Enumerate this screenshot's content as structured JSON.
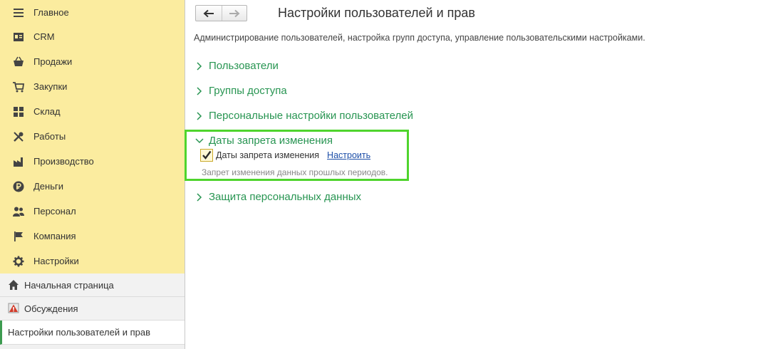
{
  "sidebar": {
    "menu": [
      {
        "label": "Главное",
        "icon": "menu-icon"
      },
      {
        "label": "CRM",
        "icon": "crm-card-icon"
      },
      {
        "label": "Продажи",
        "icon": "basket-icon"
      },
      {
        "label": "Закупки",
        "icon": "cart-icon"
      },
      {
        "label": "Склад",
        "icon": "warehouse-grid-icon"
      },
      {
        "label": "Работы",
        "icon": "tools-icon"
      },
      {
        "label": "Производство",
        "icon": "factory-icon"
      },
      {
        "label": "Деньги",
        "icon": "ruble-coin-icon"
      },
      {
        "label": "Персонал",
        "icon": "people-icon"
      },
      {
        "label": "Компания",
        "icon": "flag-icon"
      },
      {
        "label": "Настройки",
        "icon": "gear-icon"
      }
    ],
    "open_windows": [
      {
        "label": "Начальная страница",
        "icon": "home-icon"
      },
      {
        "label": "Обсуждения",
        "icon": "alert-icon"
      },
      {
        "label": "Настройки пользователей и прав",
        "active": true
      }
    ]
  },
  "header": {
    "title": "Настройки пользователей и прав",
    "description": "Администрирование пользователей, настройка групп доступа, управление пользовательскими настройками."
  },
  "sections": [
    {
      "title": "Пользователи",
      "expanded": false
    },
    {
      "title": "Группы доступа",
      "expanded": false
    },
    {
      "title": "Персональные настройки пользователей",
      "expanded": false
    },
    {
      "title": "Даты запрета изменения",
      "expanded": true
    },
    {
      "title": "Защита персональных данных",
      "expanded": false
    }
  ],
  "change_lock": {
    "checkbox_label": "Даты запрета изменения",
    "checked": true,
    "link_label": "Настроить",
    "hint": "Запрет изменения данных прошлых периодов."
  },
  "colors": {
    "accent_green": "#289552",
    "highlight": "#4fd42d",
    "sidebar_bg": "#fbec9f",
    "link": "#1d4fa8"
  }
}
